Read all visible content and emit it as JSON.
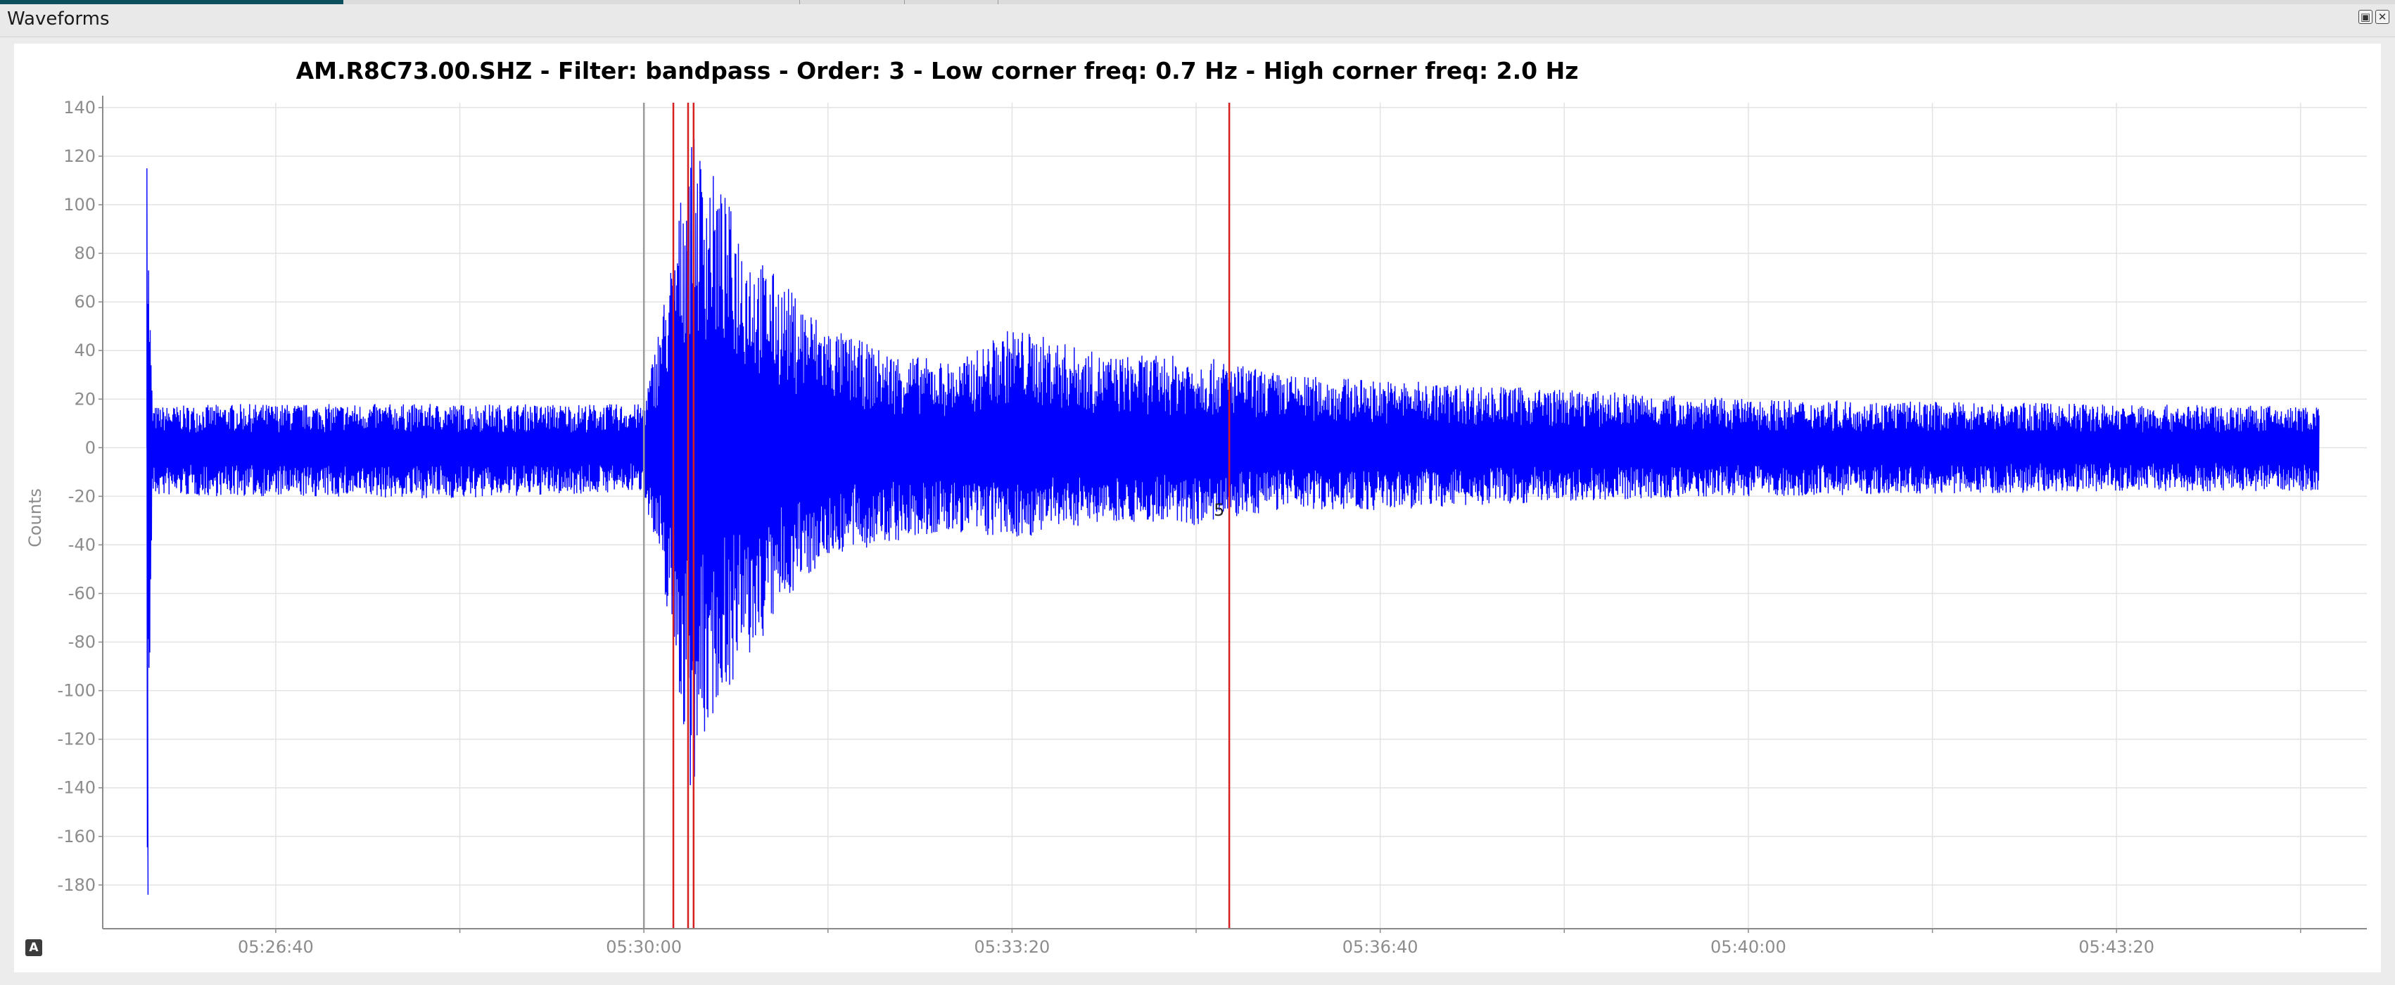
{
  "window": {
    "title": "Waveforms"
  },
  "controls": {
    "float_icon": "float-icon",
    "close_icon": "close-icon",
    "float_glyph": "▣",
    "close_glyph": "✕"
  },
  "autoscale": {
    "label": "A",
    "icon": "autoscale-icon"
  },
  "colors": {
    "trace": "#0000ff",
    "pick_line": "#d62020",
    "reference_line": "#9a9a9a",
    "grid": "#e3e3e3",
    "axis": "#8a8a8a",
    "tick_text": "#8c8c8c"
  },
  "chart_data": {
    "type": "line",
    "title": "AM.R8C73.00.SHZ - Filter: bandpass - Order: 3 - Low corner freq: 0.7 Hz - High corner freq: 2.0 Hz",
    "ylabel": "Counts",
    "xlabel": "",
    "x_tick_labels": [
      "05:26:40",
      "05:30:00",
      "05:33:20",
      "05:36:40",
      "05:40:00",
      "05:43:20"
    ],
    "x_tick_seconds": [
      400,
      600,
      800,
      1000,
      1200,
      1400
    ],
    "x_range_seconds": [
      306,
      1536
    ],
    "y_ticks": [
      140,
      120,
      100,
      80,
      60,
      40,
      20,
      0,
      -20,
      -40,
      -60,
      -80,
      -100,
      -120,
      -140,
      -160,
      -180
    ],
    "ylim": [
      -198,
      142
    ],
    "grid": true,
    "legend": "none",
    "series": [
      {
        "color": "#0000ff",
        "envelope": [
          {
            "x": 330,
            "y_max": 115,
            "y_min": -184
          },
          {
            "x": 333,
            "y_max": 17,
            "y_min": -20
          },
          {
            "x": 380,
            "y_max": 18,
            "y_min": -20
          },
          {
            "x": 500,
            "y_max": 18,
            "y_min": -21
          },
          {
            "x": 600,
            "y_max": 18,
            "y_min": -18
          },
          {
            "x": 616,
            "y_max": 82,
            "y_min": -80
          },
          {
            "x": 625,
            "y_max": 130,
            "y_min": -142
          },
          {
            "x": 640,
            "y_max": 110,
            "y_min": -105
          },
          {
            "x": 660,
            "y_max": 80,
            "y_min": -85
          },
          {
            "x": 680,
            "y_max": 65,
            "y_min": -60
          },
          {
            "x": 700,
            "y_max": 50,
            "y_min": -45
          },
          {
            "x": 730,
            "y_max": 40,
            "y_min": -40
          },
          {
            "x": 770,
            "y_max": 35,
            "y_min": -35
          },
          {
            "x": 800,
            "y_max": 50,
            "y_min": -38
          },
          {
            "x": 850,
            "y_max": 38,
            "y_min": -30
          },
          {
            "x": 900,
            "y_max": 38,
            "y_min": -32
          },
          {
            "x": 950,
            "y_max": 30,
            "y_min": -25
          },
          {
            "x": 1000,
            "y_max": 28,
            "y_min": -26
          },
          {
            "x": 1100,
            "y_max": 24,
            "y_min": -22
          },
          {
            "x": 1200,
            "y_max": 20,
            "y_min": -20
          },
          {
            "x": 1300,
            "y_max": 19,
            "y_min": -19
          },
          {
            "x": 1400,
            "y_max": 18,
            "y_min": -18
          },
          {
            "x": 1510,
            "y_max": 17,
            "y_min": -18
          }
        ]
      }
    ],
    "vertical_lines": [
      {
        "x": 600,
        "color": "#9a9a9a",
        "label": ""
      },
      {
        "x": 616,
        "color": "#d62020",
        "label": ""
      },
      {
        "x": 624,
        "color": "#d62020",
        "label": ""
      },
      {
        "x": 627,
        "color": "#d62020",
        "label": ""
      },
      {
        "x": 918,
        "color": "#d62020",
        "label": "5"
      }
    ]
  }
}
